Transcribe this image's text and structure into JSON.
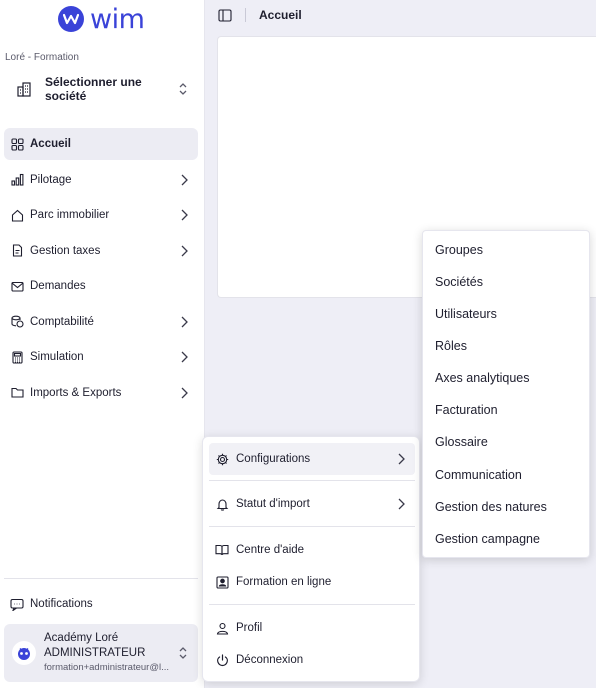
{
  "brand": {
    "name": "wim",
    "color": "#3a43d8"
  },
  "sidebar": {
    "tenant": "Loré - Formation",
    "company_selector": "Sélectionner une société",
    "items": [
      {
        "label": "Accueil",
        "icon": "grid-icon",
        "active": true,
        "has_chevron": false
      },
      {
        "label": "Pilotage",
        "icon": "bar-chart-icon",
        "has_chevron": true
      },
      {
        "label": "Parc immobilier",
        "icon": "house-icon",
        "has_chevron": true
      },
      {
        "label": "Gestion taxes",
        "icon": "document-icon",
        "has_chevron": true
      },
      {
        "label": "Demandes",
        "icon": "mail-icon",
        "has_chevron": false
      },
      {
        "label": "Comptabilité",
        "icon": "coins-icon",
        "has_chevron": true
      },
      {
        "label": "Simulation",
        "icon": "calculator-icon",
        "has_chevron": true
      },
      {
        "label": "Imports & Exports",
        "icon": "folder-icon",
        "has_chevron": true
      }
    ],
    "notifications": "Notifications",
    "user": {
      "name": "Académy Loré",
      "role": "ADMINISTRATEUR",
      "email": "formation+administrateur@l..."
    }
  },
  "topbar": {
    "title": "Accueil"
  },
  "popup_menu": {
    "items": [
      {
        "label": "Configurations",
        "icon": "gear-icon",
        "has_chevron": true
      },
      {
        "label": "Statut d'import",
        "icon": "bell-icon",
        "has_chevron": true
      },
      {
        "label": "Centre d'aide",
        "icon": "book-icon",
        "has_chevron": false
      },
      {
        "label": "Formation en ligne",
        "icon": "video-user-icon",
        "has_chevron": false
      },
      {
        "label": "Profil",
        "icon": "user-icon",
        "has_chevron": false
      },
      {
        "label": "Déconnexion",
        "icon": "power-icon",
        "has_chevron": false
      }
    ]
  },
  "submenu": {
    "items": [
      "Groupes",
      "Sociétés",
      "Utilisateurs",
      "Rôles",
      "Axes analytiques",
      "Facturation",
      "Glossaire",
      "Communication",
      "Gestion des natures",
      "Gestion campagne"
    ]
  }
}
